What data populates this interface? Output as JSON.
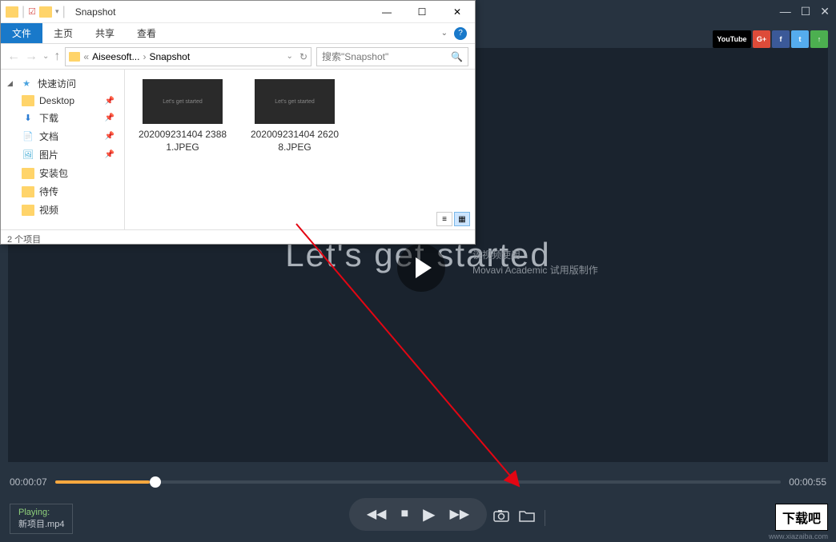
{
  "video_player": {
    "social": {
      "youtube": "YouTube",
      "gplus": "G+",
      "fb": "f",
      "tw": "t",
      "up": "↑"
    },
    "video_text": "Let's get started",
    "watermark_l1": "该视频使用",
    "watermark_l2": "Movavi Academic 试用版制作",
    "time_current": "00:00:07",
    "time_total": "00:00:55",
    "now_playing_label": "Playing:",
    "now_playing_file": "新项目.mp4",
    "download_badge": "下载吧",
    "download_url": "www.xiazaiba.com"
  },
  "explorer": {
    "title": "Snapshot",
    "tabs": {
      "file": "文件",
      "home": "主页",
      "share": "共享",
      "view": "查看"
    },
    "address": {
      "seg1": "Aiseesoft...",
      "seg2": "Snapshot"
    },
    "search_placeholder": "搜索\"Snapshot\"",
    "sidebar": {
      "quick": "快速访问",
      "desktop": "Desktop",
      "downloads": "下载",
      "docs": "文档",
      "pics": "图片",
      "pkg": "安装包",
      "pending": "待传",
      "video": "视频"
    },
    "files": [
      {
        "name": "202009231404 23881.JPEG",
        "thumb_text": "Let's get started"
      },
      {
        "name": "202009231404 26208.JPEG",
        "thumb_text": "Let's get started"
      }
    ],
    "status": "2 个项目"
  }
}
